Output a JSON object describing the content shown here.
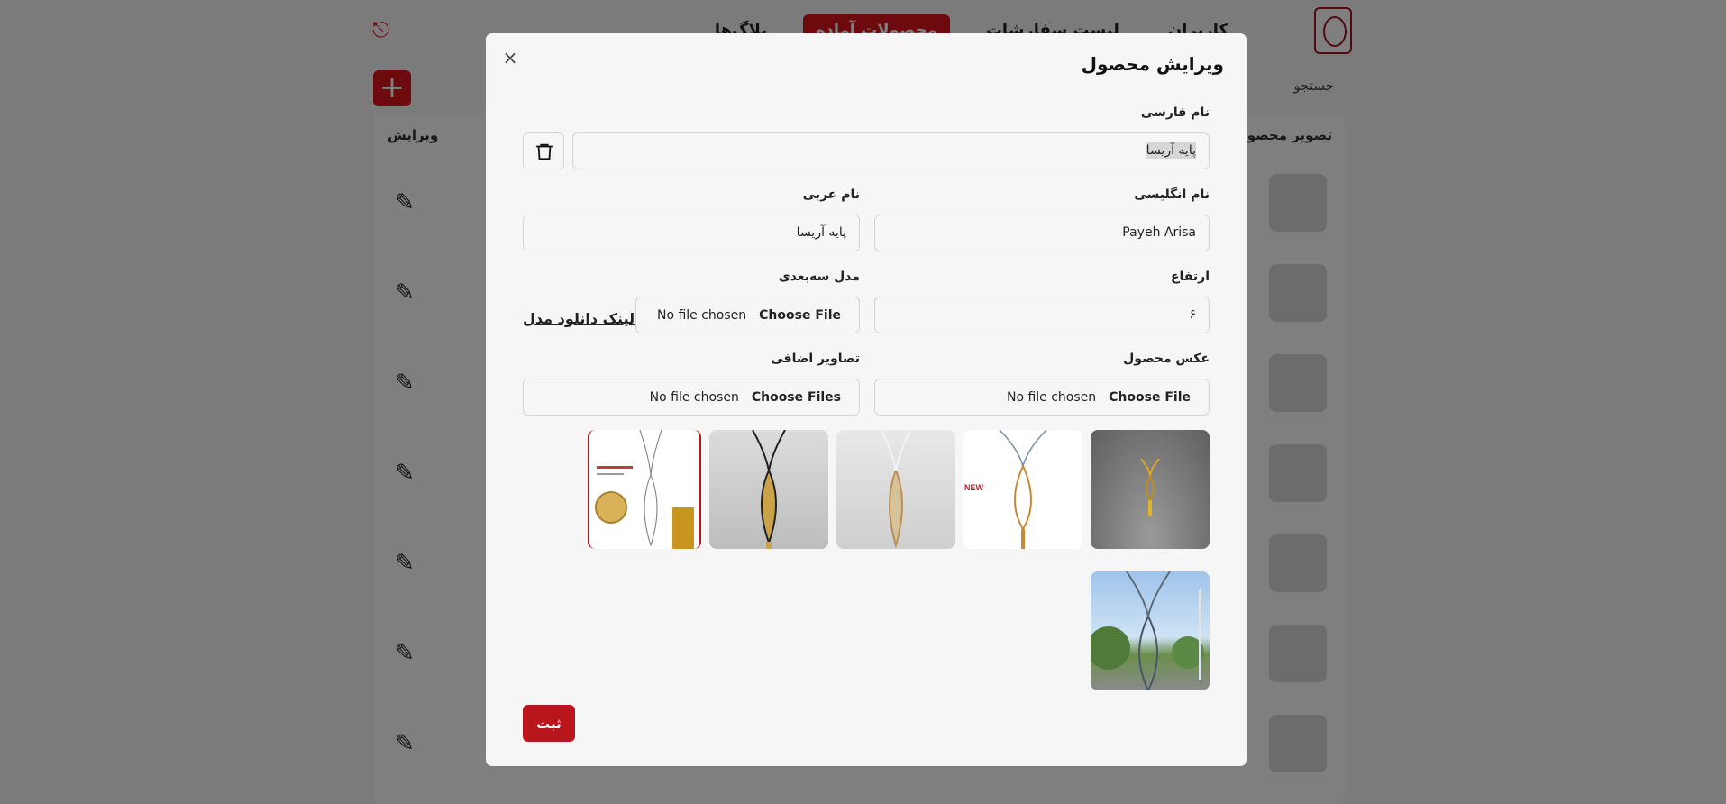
{
  "background": {
    "nav_items": [
      "کاربران",
      "لیست سفارشات",
      "محصولات آماده",
      "بلاگ‌ها"
    ],
    "active_nav_index": 2,
    "search_placeholder": "جستجو",
    "add_label": "+",
    "table_headers": {
      "image": "تصویر محصول",
      "edit": "ویرایش"
    }
  },
  "modal": {
    "title": "ویرایش محصول",
    "close_label": "×",
    "fields": {
      "persian_name": {
        "label": "نام فارسی",
        "value": "پایه آریسا"
      },
      "english_name": {
        "label": "نام انگلیسی",
        "value": "Payeh Arisa"
      },
      "arabic_name": {
        "label": "نام عربی",
        "value": "پایه آریسا"
      },
      "height": {
        "label": "ارتفاع",
        "value": "۶"
      },
      "model_3d": {
        "label": "مدل سه‌بعدی",
        "button": "Choose File",
        "status": "No file chosen",
        "download_link": "لینک دانلود مدل"
      },
      "product_image": {
        "label": "عکس محصول",
        "button": "Choose File",
        "status": "No file chosen"
      },
      "extra_images": {
        "label": "تصاویر اضافی",
        "button": "Choose Files",
        "status": "No file chosen"
      }
    },
    "thumbnails": [
      "thumb-1",
      "thumb-2",
      "thumb-3",
      "thumb-4",
      "thumb-5",
      "thumb-6"
    ],
    "thumb_new_label": "NEW",
    "submit_label": "ثبت"
  },
  "colors": {
    "accent": "#b8151c",
    "overlay": "rgba(0,0,0,0.5)"
  }
}
